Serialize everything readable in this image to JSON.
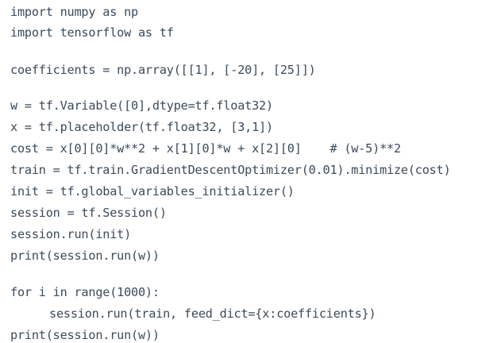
{
  "code": {
    "lines": [
      "import numpy as np",
      "import tensorflow as tf",
      "",
      "coefficients = np.array([[1], [-20], [25]])",
      "",
      "w = tf.Variable([0],dtype=tf.float32)",
      "x = tf.placeholder(tf.float32, [3,1])",
      "cost = x[0][0]*w**2 + x[1][0]*w + x[2][0]    # (w-5)**2",
      "train = tf.train.GradientDescentOptimizer(0.01).minimize(cost)",
      "init = tf.global_variables_initializer()",
      "session = tf.Session()",
      "session.run(init)",
      "print(session.run(w))",
      "",
      "for i in range(1000):",
      "session.run(train, feed_dict={x:coefficients})",
      "print(session.run(w))"
    ]
  }
}
